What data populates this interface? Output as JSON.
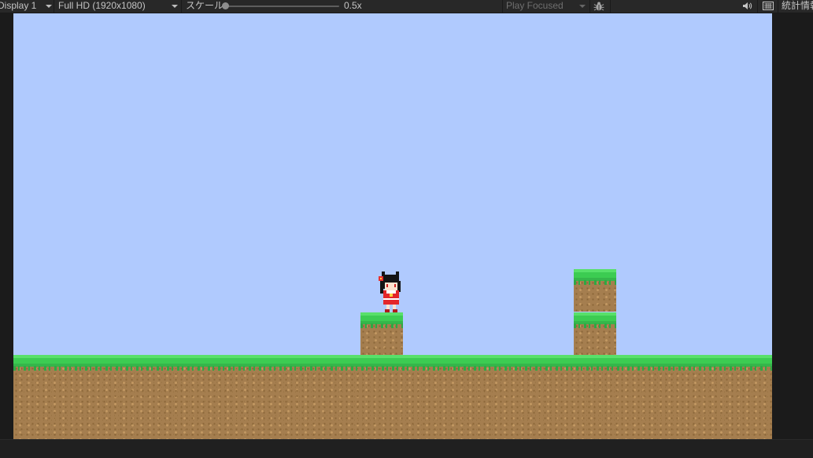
{
  "toolbar": {
    "display_label": "Display 1",
    "resolution_label": "Full HD (1920x1080)",
    "scale_label": "スケール",
    "scale_value": "0.5x",
    "play_mode_label": "Play Focused",
    "stats_label": "統計情報"
  },
  "icons": {
    "display_caret": "chevron-down-icon",
    "resolution_caret": "chevron-down-icon",
    "play_mode_caret": "chevron-down-icon",
    "bug": "bug-icon",
    "audio": "speaker-icon",
    "keyboard": "keyboard-icon"
  },
  "colors": {
    "sky": "#b0cafe",
    "grass": "#3ccc52",
    "dirt": "#a57e4f",
    "editor_bg": "#282828"
  }
}
